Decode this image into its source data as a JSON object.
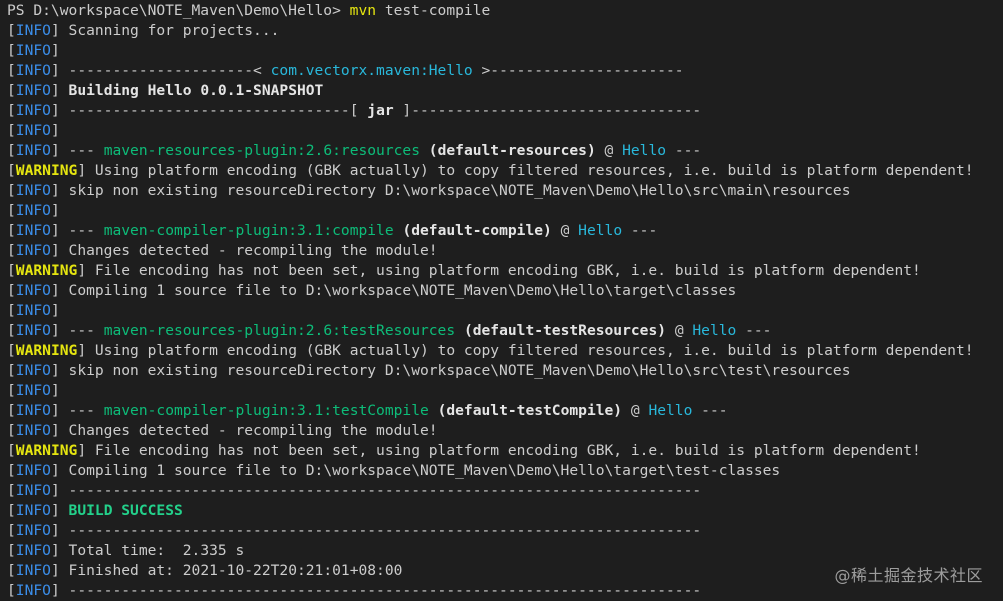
{
  "terminal": {
    "prompt": "PS D:\\workspace\\NOTE_Maven\\Demo\\Hello>",
    "command": "mvn",
    "args": "test-compile"
  },
  "lines": [
    {
      "level": "INFO",
      "segments": [
        {
          "t": " Scanning for projects...",
          "s": "default"
        }
      ]
    },
    {
      "level": "INFO",
      "segments": []
    },
    {
      "level": "INFO",
      "segments": [
        {
          "t": " ---------------------< ",
          "s": "default"
        },
        {
          "t": "com.vectorx.maven:Hello",
          "s": "cyan"
        },
        {
          "t": " >----------------------",
          "s": "default"
        }
      ]
    },
    {
      "level": "INFO",
      "segments": [
        {
          "t": " ",
          "s": "default"
        },
        {
          "t": "Building Hello 0.0.1-SNAPSHOT",
          "s": "bold"
        }
      ]
    },
    {
      "level": "INFO",
      "segments": [
        {
          "t": " --------------------------------[ ",
          "s": "default"
        },
        {
          "t": "jar",
          "s": "bold"
        },
        {
          "t": " ]---------------------------------",
          "s": "default"
        }
      ]
    },
    {
      "level": "INFO",
      "segments": []
    },
    {
      "level": "INFO",
      "segments": [
        {
          "t": " --- ",
          "s": "default"
        },
        {
          "t": "maven-resources-plugin:2.6:resources",
          "s": "plugin"
        },
        {
          "t": " ",
          "s": "default"
        },
        {
          "t": "(default-resources)",
          "s": "bold"
        },
        {
          "t": " @ ",
          "s": "default"
        },
        {
          "t": "Hello",
          "s": "cyan"
        },
        {
          "t": " ---",
          "s": "default"
        }
      ]
    },
    {
      "level": "WARNING",
      "segments": [
        {
          "t": " Using platform encoding (GBK actually) to copy filtered resources, i.e. build is platform dependent!",
          "s": "default"
        }
      ]
    },
    {
      "level": "INFO",
      "segments": [
        {
          "t": " skip non existing resourceDirectory D:\\workspace\\NOTE_Maven\\Demo\\Hello\\src\\main\\resources",
          "s": "default"
        }
      ]
    },
    {
      "level": "INFO",
      "segments": []
    },
    {
      "level": "INFO",
      "segments": [
        {
          "t": " --- ",
          "s": "default"
        },
        {
          "t": "maven-compiler-plugin:3.1:compile",
          "s": "plugin"
        },
        {
          "t": " ",
          "s": "default"
        },
        {
          "t": "(default-compile)",
          "s": "bold"
        },
        {
          "t": " @ ",
          "s": "default"
        },
        {
          "t": "Hello",
          "s": "cyan"
        },
        {
          "t": " ---",
          "s": "default"
        }
      ]
    },
    {
      "level": "INFO",
      "segments": [
        {
          "t": " Changes detected - recompiling the module!",
          "s": "default"
        }
      ]
    },
    {
      "level": "WARNING",
      "segments": [
        {
          "t": " File encoding has not been set, using platform encoding GBK, i.e. build is platform dependent!",
          "s": "default"
        }
      ]
    },
    {
      "level": "INFO",
      "segments": [
        {
          "t": " Compiling 1 source file to D:\\workspace\\NOTE_Maven\\Demo\\Hello\\target\\classes",
          "s": "default"
        }
      ]
    },
    {
      "level": "INFO",
      "segments": []
    },
    {
      "level": "INFO",
      "segments": [
        {
          "t": " --- ",
          "s": "default"
        },
        {
          "t": "maven-resources-plugin:2.6:testResources",
          "s": "plugin"
        },
        {
          "t": " ",
          "s": "default"
        },
        {
          "t": "(default-testResources)",
          "s": "bold"
        },
        {
          "t": " @ ",
          "s": "default"
        },
        {
          "t": "Hello",
          "s": "cyan"
        },
        {
          "t": " ---",
          "s": "default"
        }
      ]
    },
    {
      "level": "WARNING",
      "segments": [
        {
          "t": " Using platform encoding (GBK actually) to copy filtered resources, i.e. build is platform dependent!",
          "s": "default"
        }
      ]
    },
    {
      "level": "INFO",
      "segments": [
        {
          "t": " skip non existing resourceDirectory D:\\workspace\\NOTE_Maven\\Demo\\Hello\\src\\test\\resources",
          "s": "default"
        }
      ]
    },
    {
      "level": "INFO",
      "segments": []
    },
    {
      "level": "INFO",
      "segments": [
        {
          "t": " --- ",
          "s": "default"
        },
        {
          "t": "maven-compiler-plugin:3.1:testCompile",
          "s": "plugin"
        },
        {
          "t": " ",
          "s": "default"
        },
        {
          "t": "(default-testCompile)",
          "s": "bold"
        },
        {
          "t": " @ ",
          "s": "default"
        },
        {
          "t": "Hello",
          "s": "cyan"
        },
        {
          "t": " ---",
          "s": "default"
        }
      ]
    },
    {
      "level": "INFO",
      "segments": [
        {
          "t": " Changes detected - recompiling the module!",
          "s": "default"
        }
      ]
    },
    {
      "level": "WARNING",
      "segments": [
        {
          "t": " File encoding has not been set, using platform encoding GBK, i.e. build is platform dependent!",
          "s": "default"
        }
      ]
    },
    {
      "level": "INFO",
      "segments": [
        {
          "t": " Compiling 1 source file to D:\\workspace\\NOTE_Maven\\Demo\\Hello\\target\\test-classes",
          "s": "default"
        }
      ]
    },
    {
      "level": "INFO",
      "segments": [
        {
          "t": " ------------------------------------------------------------------------",
          "s": "default"
        }
      ]
    },
    {
      "level": "INFO",
      "segments": [
        {
          "t": " ",
          "s": "default"
        },
        {
          "t": "BUILD SUCCESS",
          "s": "success"
        }
      ]
    },
    {
      "level": "INFO",
      "segments": [
        {
          "t": " ------------------------------------------------------------------------",
          "s": "default"
        }
      ]
    },
    {
      "level": "INFO",
      "segments": [
        {
          "t": " Total time:  2.335 s",
          "s": "default"
        }
      ]
    },
    {
      "level": "INFO",
      "segments": [
        {
          "t": " Finished at: 2021-10-22T20:21:01+08:00",
          "s": "default"
        }
      ]
    },
    {
      "level": "INFO",
      "segments": [
        {
          "t": " ------------------------------------------------------------------------",
          "s": "default"
        }
      ]
    }
  ],
  "watermark": "@稀土掘金技术社区",
  "colors": {
    "background": "#1e1e1e",
    "info_level": "#3b8eea",
    "warning_level": "#e5e510",
    "plugin": "#0dbc79",
    "artifact": "#29b8db",
    "success": "#23d18b",
    "text": "#cccccc"
  }
}
